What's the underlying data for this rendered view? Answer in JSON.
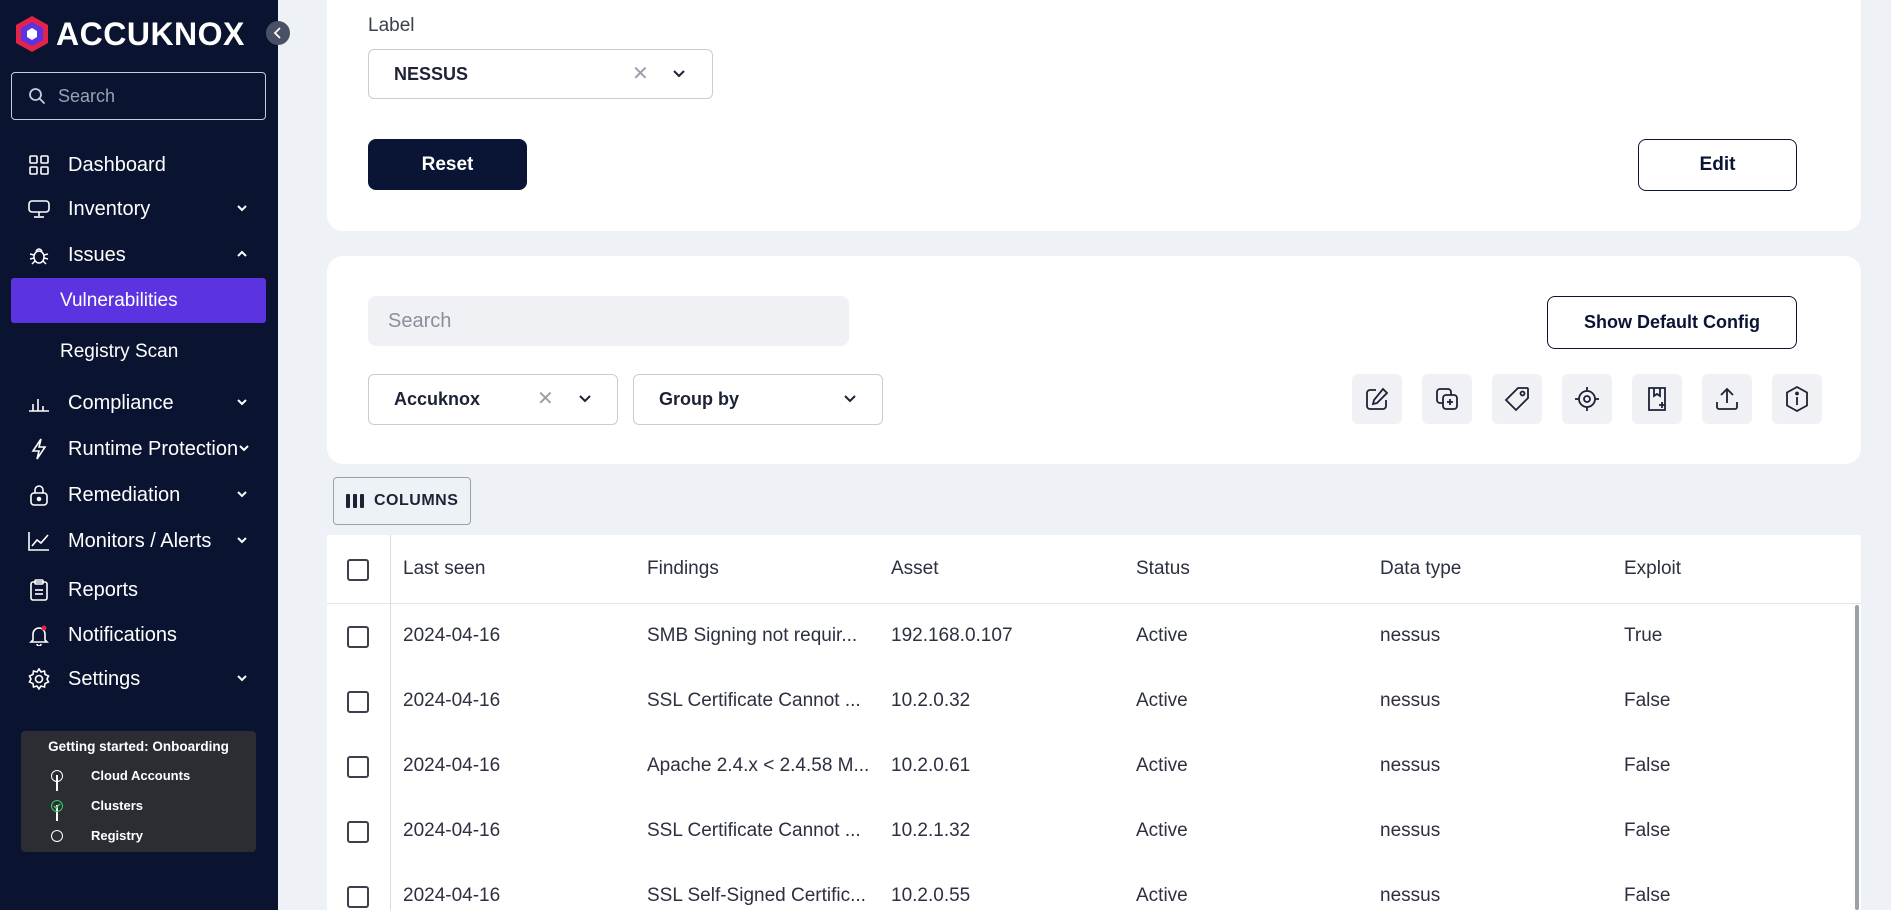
{
  "brand": {
    "name": "ACCUKNOX"
  },
  "sidebar": {
    "search_placeholder": "Search",
    "items": [
      {
        "label": "Dashboard",
        "icon": "grid-icon"
      },
      {
        "label": "Inventory",
        "icon": "monitor-icon"
      },
      {
        "label": "Issues",
        "icon": "bug-icon"
      },
      {
        "label": "Vulnerabilities"
      },
      {
        "label": "Registry Scan"
      },
      {
        "label": "Compliance",
        "icon": "compliance-chart-icon"
      },
      {
        "label": "Runtime Protection",
        "icon": "bolt-icon"
      },
      {
        "label": "Remediation",
        "icon": "lock-icon"
      },
      {
        "label": "Monitors / Alerts",
        "icon": "line-chart-icon"
      },
      {
        "label": "Reports",
        "icon": "clipboard-icon"
      },
      {
        "label": "Notifications",
        "icon": "bell-icon"
      },
      {
        "label": "Settings",
        "icon": "gear-icon"
      }
    ],
    "onboarding": {
      "title": "Getting started: Onboarding",
      "steps": [
        "Cloud Accounts",
        "Clusters",
        "Registry"
      ]
    }
  },
  "filters": {
    "label_title": "Label",
    "label_value": "NESSUS",
    "reset_label": "Reset",
    "edit_label": "Edit"
  },
  "toolbar": {
    "search_placeholder": "Search",
    "default_config_label": "Show Default Config",
    "tenant_value": "Accuknox",
    "group_by_label": "Group by",
    "columns_label": "COLUMNS"
  },
  "table": {
    "headers": [
      "Last seen",
      "Findings",
      "Asset",
      "Status",
      "Data type",
      "Exploit"
    ],
    "rows": [
      [
        "2024-04-16",
        "SMB Signing not requir...",
        "192.168.0.107",
        "Active",
        "nessus",
        "True"
      ],
      [
        "2024-04-16",
        "SSL Certificate Cannot ...",
        "10.2.0.32",
        "Active",
        "nessus",
        "False"
      ],
      [
        "2024-04-16",
        "Apache 2.4.x < 2.4.58 M...",
        "10.2.0.61",
        "Active",
        "nessus",
        "False"
      ],
      [
        "2024-04-16",
        "SSL Certificate Cannot ...",
        "10.2.1.32",
        "Active",
        "nessus",
        "False"
      ],
      [
        "2024-04-16",
        "SSL Self-Signed Certific...",
        "10.2.0.55",
        "Active",
        "nessus",
        "False"
      ]
    ]
  },
  "colors": {
    "sidebar_bg": "#0a1431",
    "accent": "#5b33e0",
    "primary_button": "#0a1434"
  }
}
